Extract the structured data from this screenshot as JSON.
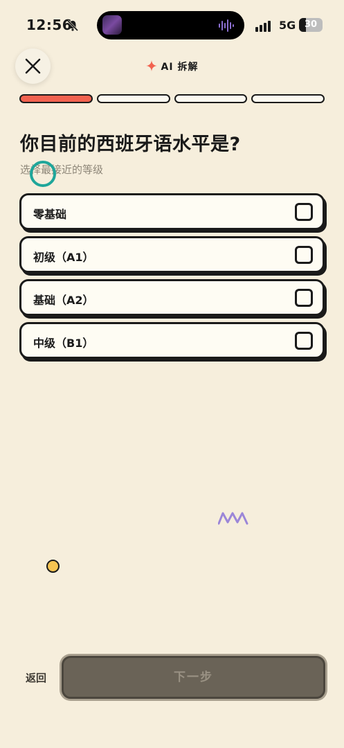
{
  "status_bar": {
    "time": "12:56",
    "network": "5G",
    "battery_text": "30",
    "battery_level": 0.3,
    "icons": [
      "bell-muted-icon",
      "signal-icon",
      "battery-icon"
    ]
  },
  "header": {
    "title": "AI 拆解",
    "icons": [
      "close-icon",
      "sparkle-icon"
    ]
  },
  "progress": {
    "total_steps": 4,
    "current_step": 1
  },
  "question": {
    "title": "你目前的西班牙语水平是?",
    "subtitle": "选择最接近的等级"
  },
  "options": [
    {
      "label": "零基础",
      "checked": false
    },
    {
      "label": "初级（A1）",
      "checked": false
    },
    {
      "label": "基础（A2）",
      "checked": false
    },
    {
      "label": "中级（B1）",
      "checked": false
    }
  ],
  "footer": {
    "back_label": "返回",
    "next_label": "下一步"
  },
  "colors": {
    "background": "#F6EEDC",
    "accent": "#F2624F",
    "teal_ring": "#1FA69A",
    "zigzag": "#9B86D8",
    "dot": "#F6C452",
    "button_disabled": "#6A6357"
  }
}
